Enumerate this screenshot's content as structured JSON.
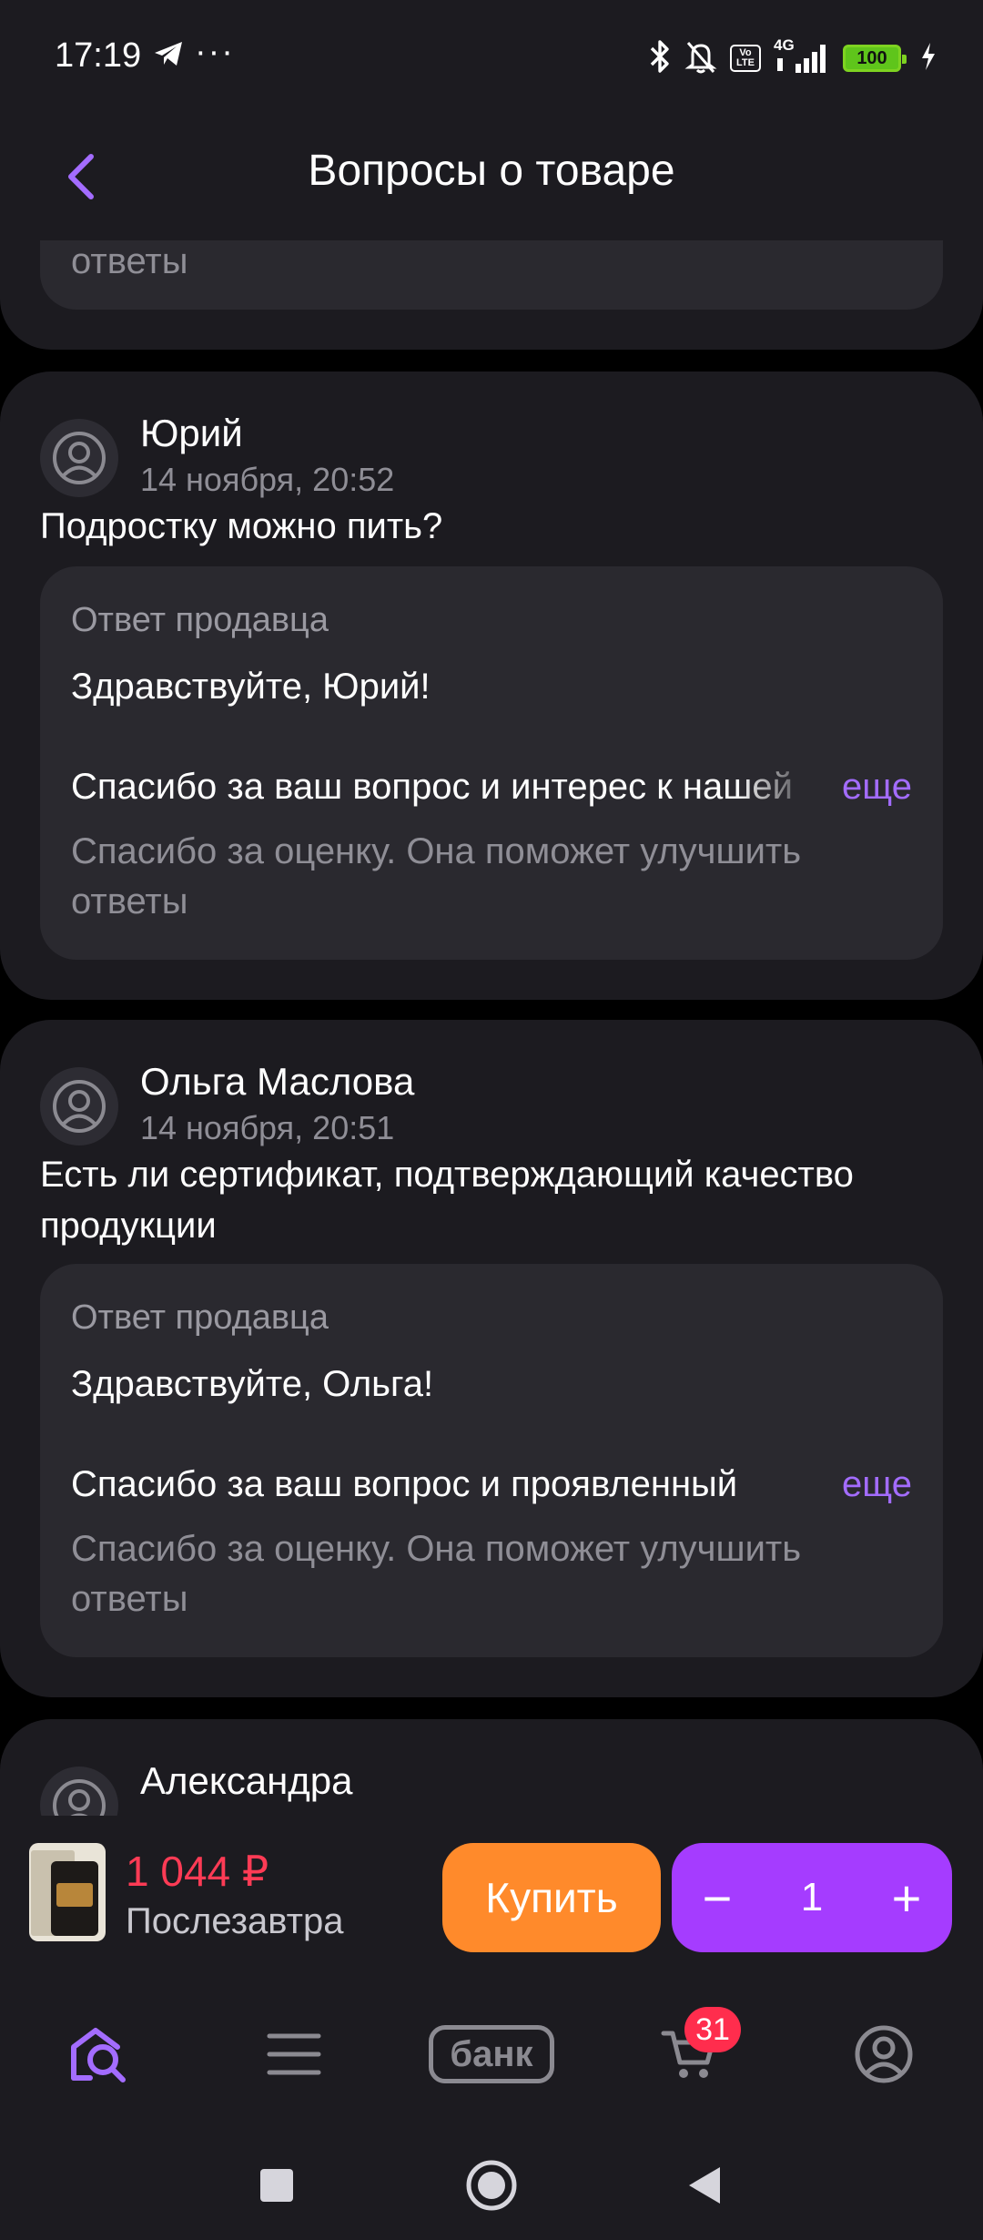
{
  "status_bar": {
    "time": "17:19",
    "battery": "100",
    "icons": [
      "telegram-icon",
      "more-dots-icon",
      "bluetooth-icon",
      "bell-off-icon",
      "volte-icon",
      "signal-4g-icon",
      "battery-icon",
      "charging-icon"
    ],
    "dots": "···",
    "volte": "Vo LTE",
    "network": "4G"
  },
  "header": {
    "title": "Вопросы о товаре",
    "back_icon": "chevron-left-icon"
  },
  "colors": {
    "accent": "#a36cff",
    "price": "#ff3b55",
    "buy_button": "#ff8a2b",
    "stepper": "#a53cff",
    "badge": "#ff2d4d"
  },
  "questions": [
    {
      "answer_tail": "ответы"
    },
    {
      "author": "Юрий",
      "date": "14 ноября, 20:52",
      "question": "Подростку можно пить?",
      "answer_label": "Ответ продавца",
      "greeting": "Здравствуйте, Юрий!",
      "body_preview": "Спасибо за ваш вопрос и интерес к нашей",
      "more": "еще",
      "rating_line1": "Спасибо за оценку. Она поможет улучшить",
      "rating_line2": "ответы"
    },
    {
      "author": "Ольга Маслова",
      "date": "14 ноября, 20:51",
      "question_line1": "Есть ли сертификат, подтверждающий качество",
      "question_line2": "продукции",
      "answer_label": "Ответ продавца",
      "greeting": "Здравствуйте, Ольга!",
      "body_preview": "Спасибо за ваш вопрос и проявленный",
      "more": "еще",
      "rating_line1": "Спасибо за оценку. Она поможет улучшить",
      "rating_line2": "ответы"
    },
    {
      "author": "Александра"
    }
  ],
  "buy_bar": {
    "price": "1 044 ₽",
    "delivery": "Послезавтра",
    "buy_label": "Купить",
    "minus": "−",
    "quantity": "1",
    "plus": "+"
  },
  "tab_bar": {
    "tabs": [
      "home-search-icon",
      "catalog-menu-icon",
      "bank-icon",
      "cart-icon",
      "profile-icon"
    ],
    "bank_label": "банк",
    "cart_badge": "31"
  },
  "nav_bar": {
    "buttons": [
      "recents-square-icon",
      "home-circle-icon",
      "back-triangle-icon"
    ]
  }
}
